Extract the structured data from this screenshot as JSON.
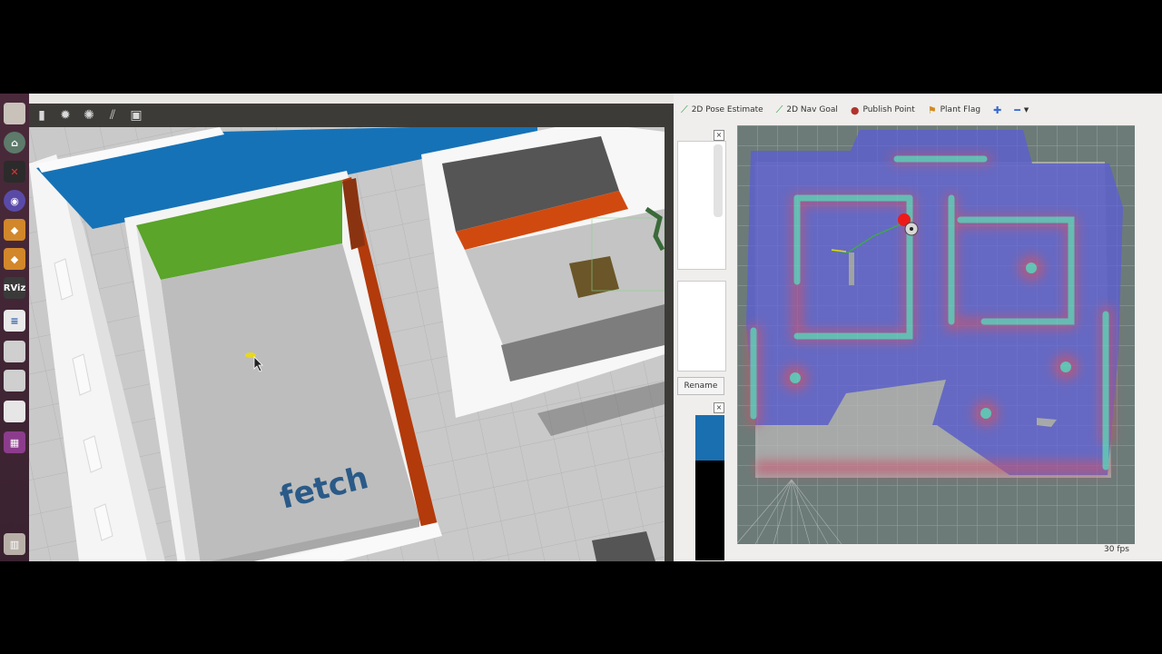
{
  "rviz": {
    "toolbar": [
      {
        "label": "2D Pose Estimate",
        "icon": "pose-arrow-icon",
        "color": "#2e9a3c"
      },
      {
        "label": "2D Nav Goal",
        "icon": "nav-arrow-icon",
        "color": "#2e9a3c"
      },
      {
        "label": "Publish Point",
        "icon": "map-pin-icon",
        "color": "#b0342c"
      },
      {
        "label": "Plant Flag",
        "icon": "flag-icon",
        "color": "#d08a1a"
      }
    ],
    "rename_label": "Rename",
    "fps": "30 fps"
  },
  "gazebo": {
    "logo_text": "fetch"
  },
  "launcher": {
    "rviz_label": "RViz"
  }
}
